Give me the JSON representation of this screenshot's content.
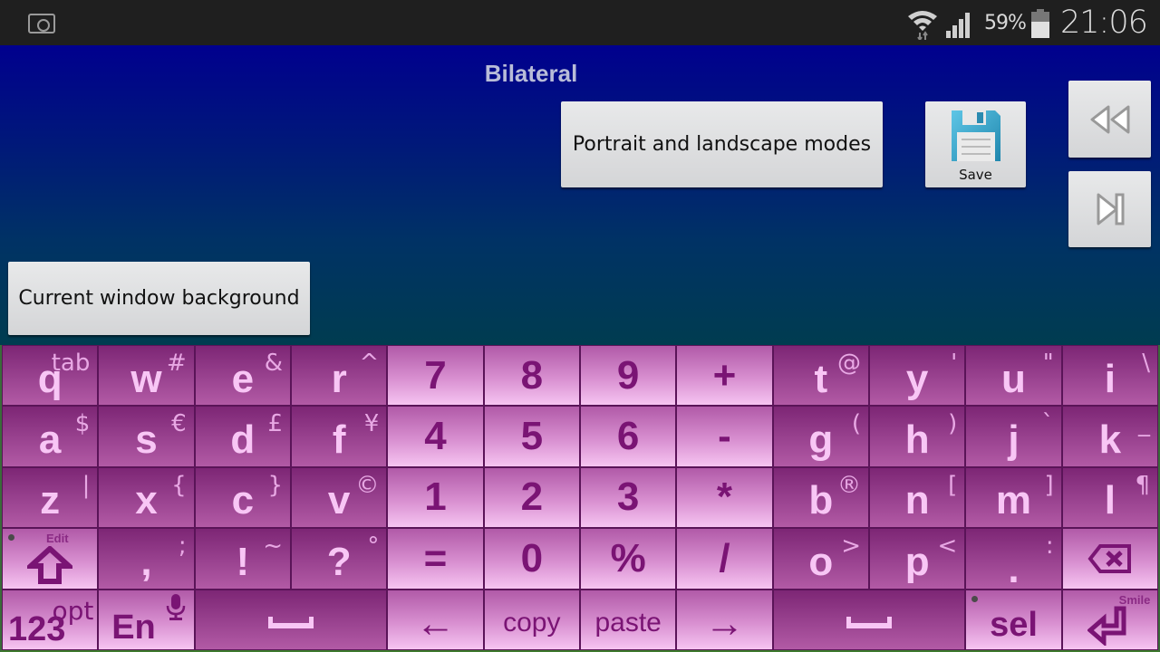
{
  "status_bar": {
    "screenshot_icon": "camera-icon",
    "wifi_icon": "wifi-icon",
    "signal_icon": "signal-icon",
    "battery_percent": "59%",
    "battery_icon": "battery-icon",
    "time": "21:06"
  },
  "app": {
    "title": "Bilateral",
    "buttons": {
      "portrait": "Portrait and landscape modes",
      "save": "Save",
      "rewind_icon": "rewind-icon",
      "skip_icon": "skip-to-end-icon",
      "background": "Current window background"
    }
  },
  "keyboard": {
    "colors": {
      "dark_key": "#9a4390",
      "light_key": "#d88fd0",
      "dark_text": "#f8c6f5",
      "light_text": "#7a1474"
    },
    "rows": [
      [
        {
          "main": "q",
          "alt": "tab",
          "style": "dark"
        },
        {
          "main": "w",
          "alt": "#",
          "style": "dark"
        },
        {
          "main": "e",
          "alt": "&",
          "style": "dark"
        },
        {
          "main": "r",
          "alt": "^",
          "style": "dark"
        },
        {
          "main": "7",
          "alt": "",
          "style": "light"
        },
        {
          "main": "8",
          "alt": "",
          "style": "light"
        },
        {
          "main": "9",
          "alt": "",
          "style": "light"
        },
        {
          "main": "+",
          "alt": "",
          "style": "light"
        },
        {
          "main": "t",
          "alt": "@",
          "style": "dark"
        },
        {
          "main": "y",
          "alt": "'",
          "style": "dark"
        },
        {
          "main": "u",
          "alt": "\"",
          "style": "dark"
        },
        {
          "main": "i",
          "alt": "\\",
          "style": "dark"
        }
      ],
      [
        {
          "main": "a",
          "alt": "$",
          "style": "dark"
        },
        {
          "main": "s",
          "alt": "€",
          "style": "dark"
        },
        {
          "main": "d",
          "alt": "£",
          "style": "dark"
        },
        {
          "main": "f",
          "alt": "¥",
          "style": "dark"
        },
        {
          "main": "4",
          "alt": "",
          "style": "light"
        },
        {
          "main": "5",
          "alt": "",
          "style": "light"
        },
        {
          "main": "6",
          "alt": "",
          "style": "light"
        },
        {
          "main": "-",
          "alt": "",
          "style": "light"
        },
        {
          "main": "g",
          "alt": "(",
          "style": "dark"
        },
        {
          "main": "h",
          "alt": ")",
          "style": "dark"
        },
        {
          "main": "j",
          "alt": "`",
          "style": "dark"
        },
        {
          "main": "k",
          "alt": "_",
          "style": "dark"
        }
      ],
      [
        {
          "main": "z",
          "alt": "|",
          "style": "dark"
        },
        {
          "main": "x",
          "alt": "{",
          "style": "dark"
        },
        {
          "main": "c",
          "alt": "}",
          "style": "dark"
        },
        {
          "main": "v",
          "alt": "©",
          "style": "dark"
        },
        {
          "main": "1",
          "alt": "",
          "style": "light"
        },
        {
          "main": "2",
          "alt": "",
          "style": "light"
        },
        {
          "main": "3",
          "alt": "",
          "style": "light"
        },
        {
          "main": "*",
          "alt": "",
          "style": "light"
        },
        {
          "main": "b",
          "alt": "®",
          "style": "dark"
        },
        {
          "main": "n",
          "alt": "[",
          "style": "dark"
        },
        {
          "main": "m",
          "alt": "]",
          "style": "dark"
        },
        {
          "main": "l",
          "alt": "¶",
          "style": "dark"
        }
      ],
      [
        {
          "main": "⇧",
          "alt": "",
          "label_top": "Edit",
          "style": "light",
          "icon": "shift-icon"
        },
        {
          "main": ",",
          "alt": ";",
          "style": "dark"
        },
        {
          "main": "!",
          "alt": "~",
          "style": "dark"
        },
        {
          "main": "?",
          "alt": "°",
          "style": "dark"
        },
        {
          "main": "=",
          "alt": "",
          "style": "light"
        },
        {
          "main": "0",
          "alt": "",
          "style": "light"
        },
        {
          "main": "%",
          "alt": "",
          "style": "light"
        },
        {
          "main": "/",
          "alt": "",
          "style": "light"
        },
        {
          "main": "o",
          "alt": ">",
          "style": "dark"
        },
        {
          "main": "p",
          "alt": "<",
          "style": "dark"
        },
        {
          "main": ".",
          "alt": ":",
          "style": "dark"
        },
        {
          "main": "⌫",
          "alt": "",
          "style": "light",
          "icon": "backspace-icon"
        }
      ],
      [
        {
          "main": "123",
          "alt": "opt",
          "style": "light",
          "span": 1
        },
        {
          "main": "En",
          "alt": "",
          "style": "light",
          "span": 1,
          "icon": "microphone-icon"
        },
        {
          "main": "␣",
          "alt": "",
          "style": "dark",
          "span": 2,
          "icon": "space-icon"
        },
        {
          "main": "←",
          "alt": "",
          "style": "light",
          "span": 1
        },
        {
          "main": "copy",
          "alt": "",
          "style": "light",
          "span": 1
        },
        {
          "main": "paste",
          "alt": "",
          "style": "light",
          "span": 1
        },
        {
          "main": "→",
          "alt": "",
          "style": "light",
          "span": 1
        },
        {
          "main": "␣",
          "alt": "",
          "style": "dark",
          "span": 2,
          "icon": "space-icon"
        },
        {
          "main": "sel",
          "alt": "",
          "style": "light",
          "span": 1
        },
        {
          "main": "↵",
          "alt": "",
          "label_top": "Smile",
          "style": "light",
          "span": 1,
          "icon": "enter-icon"
        }
      ]
    ]
  }
}
